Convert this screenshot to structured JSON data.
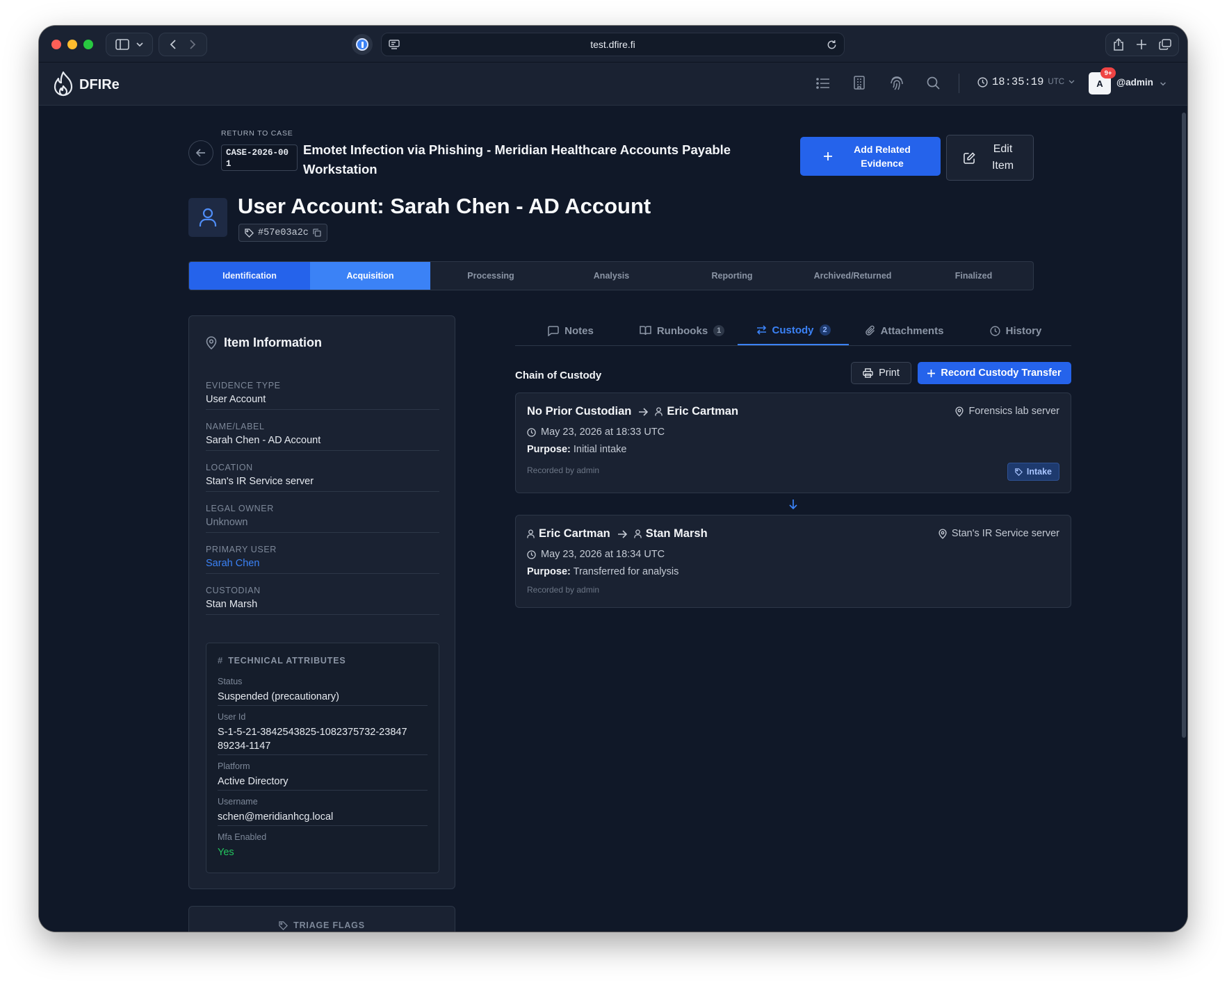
{
  "browser": {
    "url": "test.dfire.fi"
  },
  "nav": {
    "brand": "DFIRe",
    "time": "18:35:19",
    "tz": "UTC",
    "avatar_letter": "A",
    "notif_badge": "9+",
    "username": "@admin"
  },
  "header": {
    "return_label": "RETURN TO CASE",
    "case_id": "CASE-2026-001",
    "case_title": "Emotet Infection via Phishing - Meridian Healthcare Accounts Payable Workstation",
    "add_related_label": "Add Related Evidence",
    "edit_label": "Edit Item",
    "item_title": "User Account: Sarah Chen - AD Account",
    "item_hash": "#57e03a2c"
  },
  "stages": [
    {
      "label": "Identification",
      "state": "done"
    },
    {
      "label": "Acquisition",
      "state": "current"
    },
    {
      "label": "Processing",
      "state": "pending"
    },
    {
      "label": "Analysis",
      "state": "pending"
    },
    {
      "label": "Reporting",
      "state": "pending"
    },
    {
      "label": "Archived/Returned",
      "state": "pending"
    },
    {
      "label": "Finalized",
      "state": "pending"
    }
  ],
  "item_info": {
    "title": "Item Information",
    "fields": [
      {
        "label": "EVIDENCE TYPE",
        "value": "User Account"
      },
      {
        "label": "NAME/LABEL",
        "value": "Sarah Chen - AD Account"
      },
      {
        "label": "LOCATION",
        "value": "Stan's IR Service server"
      },
      {
        "label": "LEGAL OWNER",
        "value": "Unknown"
      },
      {
        "label": "PRIMARY USER",
        "value": "Sarah Chen"
      },
      {
        "label": "CUSTODIAN",
        "value": "Stan Marsh"
      }
    ],
    "tech_title": "TECHNICAL ATTRIBUTES",
    "tech_attrs": [
      {
        "label": "Status",
        "value": "Suspended (precautionary)"
      },
      {
        "label": "User Id",
        "value": "S-1-5-21-3842543825-1082375732-2384789234-1147"
      },
      {
        "label": "Platform",
        "value": "Active Directory"
      },
      {
        "label": "Username",
        "value": "schen@meridianhcg.local"
      },
      {
        "label": "Mfa Enabled",
        "value": "Yes"
      }
    ],
    "triage_title": "TRIAGE FLAGS"
  },
  "tabs": {
    "notes": "Notes",
    "runbooks": "Runbooks",
    "runbooks_count": "1",
    "custody": "Custody",
    "custody_count": "2",
    "attachments": "Attachments",
    "history": "History"
  },
  "custody": {
    "title": "Chain of Custody",
    "print_label": "Print",
    "record_label": "Record Custody Transfer",
    "purpose_label": "Purpose:",
    "entries": [
      {
        "from": "No Prior Custodian",
        "to": "Eric Cartman",
        "location": "Forensics lab server",
        "datetime": "May 23, 2026 at 18:33 UTC",
        "purpose": "Initial intake",
        "recorded_by": "Recorded by admin",
        "tag": "Intake"
      },
      {
        "from": "Eric Cartman",
        "to": "Stan Marsh",
        "location": "Stan's IR Service server",
        "datetime": "May 23, 2026 at 18:34 UTC",
        "purpose": "Transferred for analysis",
        "recorded_by": "Recorded by admin"
      }
    ]
  },
  "colors": {
    "accent": "#2563eb",
    "accent_text": "#3b82f6",
    "background": "#101828",
    "panel": "#1a2232",
    "success": "#22c55e",
    "notif": "#ef4444"
  }
}
